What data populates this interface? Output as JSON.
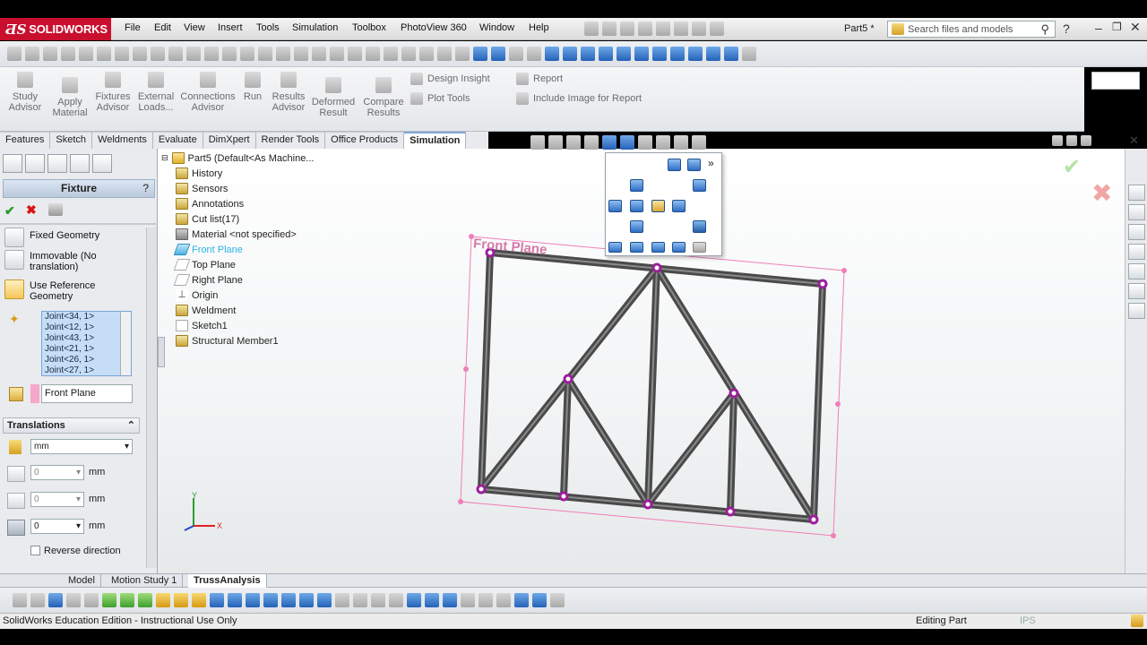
{
  "app": {
    "logo": "SOLIDWORKS",
    "doc_name": "Part5 *",
    "search_placeholder": "Search files and models"
  },
  "menu": [
    "File",
    "Edit",
    "View",
    "Insert",
    "Tools",
    "Simulation",
    "Toolbox",
    "PhotoView 360",
    "Window",
    "Help"
  ],
  "command_manager": {
    "buttons": [
      {
        "label": "Study Advisor"
      },
      {
        "label": "Apply Material"
      },
      {
        "label": "Fixtures Advisor"
      },
      {
        "label": "External Loads..."
      },
      {
        "label": "Connections Advisor"
      },
      {
        "label": "Run"
      },
      {
        "label": "Results Advisor"
      },
      {
        "label": "Deformed Result"
      },
      {
        "label": "Compare Results"
      }
    ],
    "small_buttons": [
      "Design Insight",
      "Plot Tools",
      "Report",
      "Include Image for Report"
    ]
  },
  "tabs": [
    "Features",
    "Sketch",
    "Weldments",
    "Evaluate",
    "DimXpert",
    "Render Tools",
    "Office Products",
    "Simulation"
  ],
  "active_tab": "Simulation",
  "fixture_panel": {
    "title": "Fixture",
    "help": "?",
    "options": [
      "Fixed Geometry",
      "Immovable (No translation)",
      "Use Reference Geometry"
    ],
    "joints": [
      "Joint<34, 1>",
      "Joint<12, 1>",
      "Joint<43, 1>",
      "Joint<21, 1>",
      "Joint<26, 1>",
      "Joint<27, 1>"
    ],
    "reference": "Front Plane",
    "translations": {
      "header": "Translations",
      "unit": "mm",
      "fields": [
        {
          "value": "0",
          "unit": "mm"
        },
        {
          "value": "0",
          "unit": "mm"
        },
        {
          "value": "0",
          "unit": "mm"
        }
      ],
      "reverse_label": "Reverse direction"
    }
  },
  "tree": {
    "root": "Part5  (Default<As Machine...",
    "items": [
      "History",
      "Sensors",
      "Annotations",
      "Cut list(17)",
      "Material <not specified>",
      "Front Plane",
      "Top Plane",
      "Right Plane",
      "Origin",
      "Weldment",
      "Sketch1",
      "Structural Member1"
    ]
  },
  "viewport": {
    "plane_label": "Front Plane",
    "axis_x": "X",
    "axis_y": "Y"
  },
  "bottom_tabs": [
    "Model",
    "Motion Study 1",
    "TrussAnalysis"
  ],
  "status": {
    "left": "SolidWorks Education Edition - Instructional Use Only",
    "mode": "Editing Part",
    "units": "IPS"
  }
}
